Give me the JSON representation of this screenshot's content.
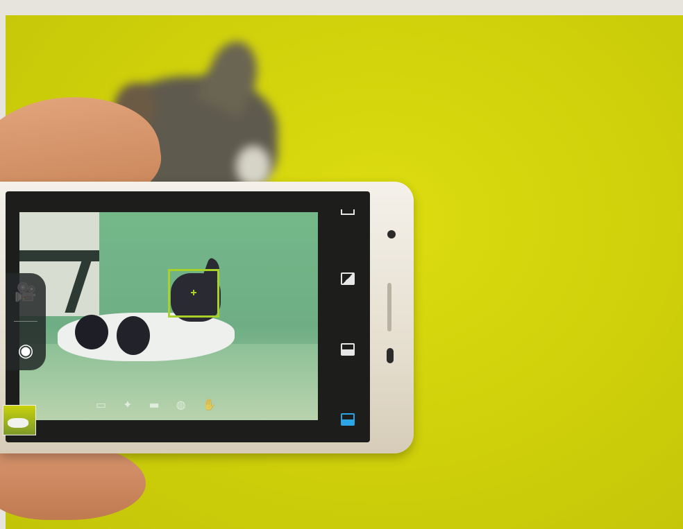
{
  "scene": {
    "description_colors": {
      "backdrop": "#cfd00a",
      "focus_box": "#a8d22a",
      "active_icon": "#2aa6e6"
    }
  },
  "camera_ui": {
    "mode_buttons": [
      {
        "icon": "video-camera-icon",
        "glyph": "🎥"
      },
      {
        "icon": "shutter-icon",
        "glyph": "◉"
      }
    ],
    "bottom_icons": [
      "▭",
      "✦",
      "▬",
      "◍",
      "✋"
    ],
    "side_icons": [
      "collapse-icon",
      "filter-icon",
      "scene-icon",
      "mode-icon"
    ]
  }
}
